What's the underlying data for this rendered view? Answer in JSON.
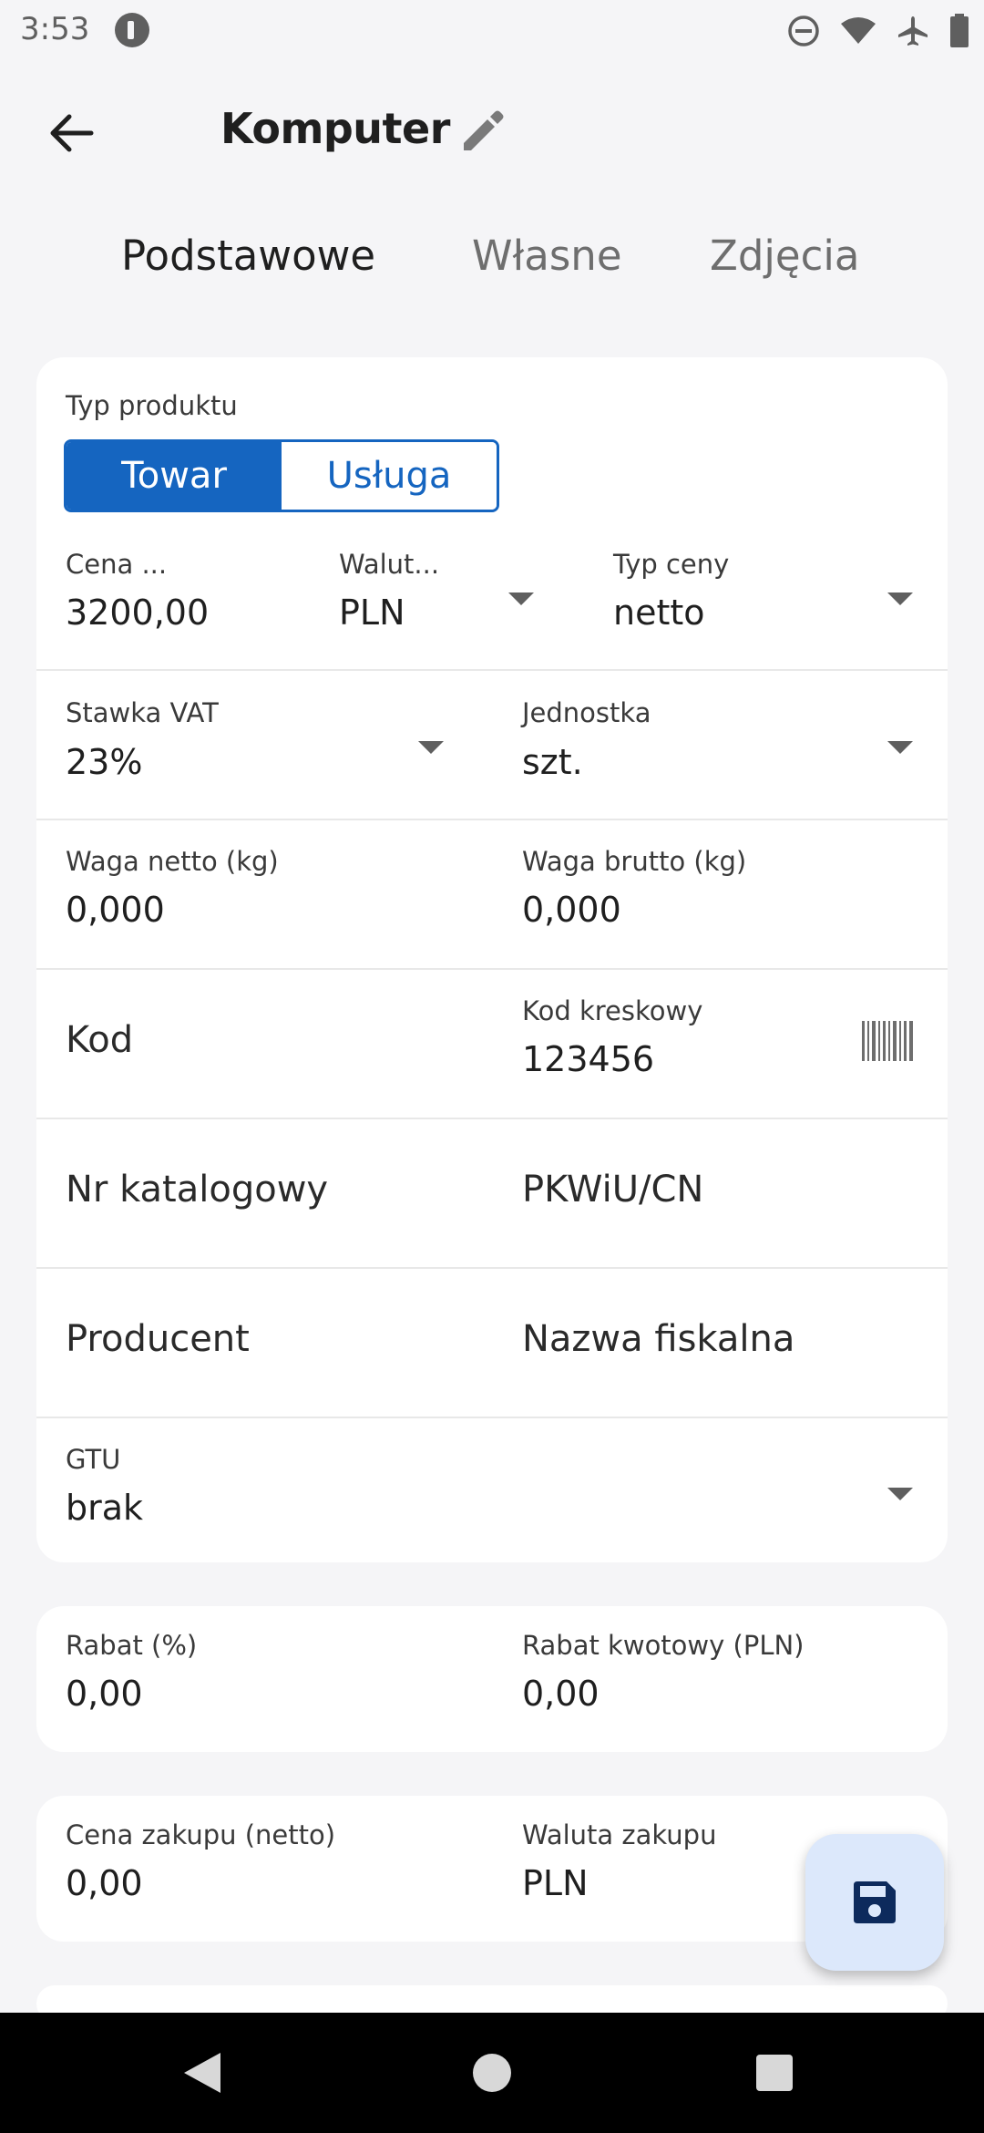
{
  "status_bar": {
    "time": "3:53"
  },
  "header": {
    "title": "Komputer"
  },
  "tabs": [
    {
      "label": "Podstawowe",
      "active": true
    },
    {
      "label": "Własne",
      "active": false
    },
    {
      "label": "Zdjęcia",
      "active": false
    }
  ],
  "product_type": {
    "label": "Typ produktu",
    "options": [
      "Towar",
      "Usługa"
    ],
    "selected": "Towar"
  },
  "price": {
    "label": "Cena ...",
    "value": "3200,00"
  },
  "currency": {
    "label": "Walut...",
    "value": "PLN"
  },
  "price_type": {
    "label": "Typ ceny",
    "value": "netto"
  },
  "vat_rate": {
    "label": "Stawka VAT",
    "value": "23%"
  },
  "unit": {
    "label": "Jednostka",
    "value": "szt."
  },
  "net_weight": {
    "label": "Waga netto (kg)",
    "value": "0,000"
  },
  "gross_weight": {
    "label": "Waga brutto (kg)",
    "value": "0,000"
  },
  "code": {
    "placeholder": "Kod"
  },
  "barcode": {
    "label": "Kod kreskowy",
    "value": "123456"
  },
  "catalog_no": {
    "placeholder": "Nr katalogowy"
  },
  "pkwiu": {
    "placeholder": "PKWiU/CN"
  },
  "producer": {
    "placeholder": "Producent"
  },
  "fiscal_name": {
    "placeholder": "Nazwa fiskalna"
  },
  "gtu": {
    "label": "GTU",
    "value": "brak"
  },
  "discount_pct": {
    "label": "Rabat (%)",
    "value": "0,00"
  },
  "discount_amount": {
    "label": "Rabat kwotowy (PLN)",
    "value": "0,00"
  },
  "purchase_price": {
    "label": "Cena zakupu (netto)",
    "value": "0,00"
  },
  "purchase_currency": {
    "label": "Waluta zakupu",
    "value": "PLN"
  },
  "colors": {
    "accent": "#1565c0",
    "fab_bg": "#dce8fb",
    "fab_icon": "#0d2a5c"
  },
  "icons": [
    "back-arrow-icon",
    "pencil-icon",
    "barcode-icon",
    "save-icon"
  ]
}
